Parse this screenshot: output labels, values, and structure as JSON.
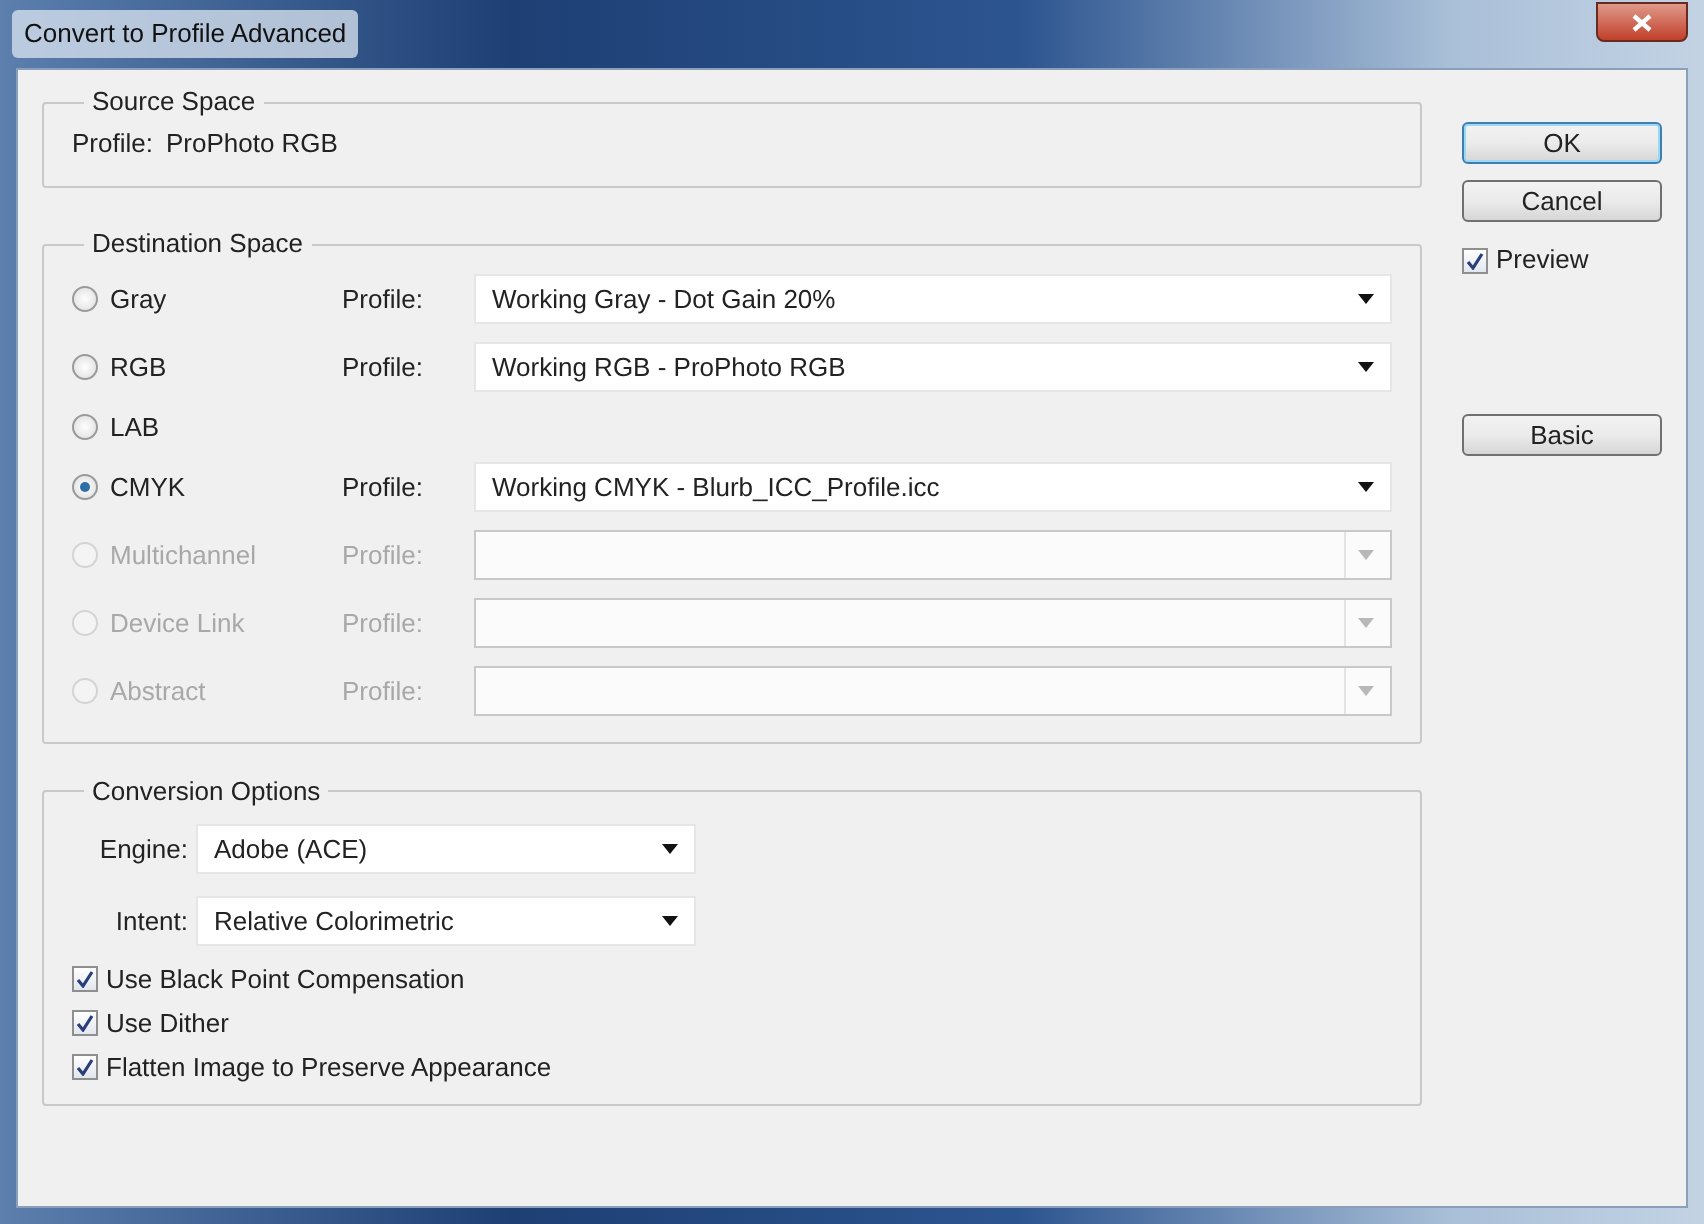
{
  "window": {
    "title": "Convert to Profile Advanced"
  },
  "source_space": {
    "legend": "Source Space",
    "label": "Profile:",
    "value": "ProPhoto RGB"
  },
  "destination_space": {
    "legend": "Destination Space",
    "options": [
      {
        "label": "Gray",
        "selected": false,
        "disabled": false,
        "profile": {
          "label": "Profile:",
          "value": "Working Gray - Dot Gain 20%"
        }
      },
      {
        "label": "RGB",
        "selected": false,
        "disabled": false,
        "profile": {
          "label": "Profile:",
          "value": "Working RGB - ProPhoto RGB"
        }
      },
      {
        "label": "LAB",
        "selected": false,
        "disabled": false
      },
      {
        "label": "CMYK",
        "selected": true,
        "disabled": false,
        "profile": {
          "label": "Profile:",
          "value": "Working CMYK - Blurb_ICC_Profile.icc"
        }
      },
      {
        "label": "Multichannel",
        "selected": false,
        "disabled": true,
        "profile": {
          "label": "Profile:"
        }
      },
      {
        "label": "Device Link",
        "selected": false,
        "disabled": true,
        "profile": {
          "label": "Profile:"
        }
      },
      {
        "label": "Abstract",
        "selected": false,
        "disabled": true,
        "profile": {
          "label": "Profile:"
        }
      }
    ]
  },
  "conversion_options": {
    "legend": "Conversion Options",
    "engine": {
      "label": "Engine:",
      "value": "Adobe (ACE)"
    },
    "intent": {
      "label": "Intent:",
      "value": "Relative Colorimetric"
    },
    "checkboxes": [
      {
        "label": "Use Black Point Compensation",
        "checked": true
      },
      {
        "label": "Use Dither",
        "checked": true
      },
      {
        "label": "Flatten Image to Preserve Appearance",
        "checked": true
      }
    ]
  },
  "buttons": [
    {
      "label": "OK",
      "default": true
    },
    {
      "label": "Cancel",
      "default": false
    }
  ],
  "preview": {
    "label": "Preview",
    "checked": true
  },
  "basic_button": {
    "label": "Basic"
  }
}
